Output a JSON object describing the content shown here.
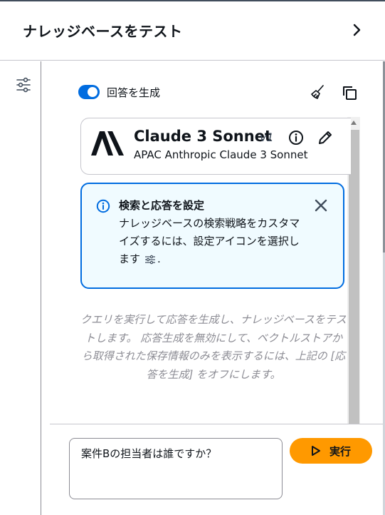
{
  "header": {
    "title": "ナレッジベースをテスト"
  },
  "icons": {
    "expand": "chevron-right-icon",
    "settings": "settings-sliders-icon",
    "clear": "broom-icon",
    "copy": "copy-icon",
    "info": "info-circle-icon",
    "edit": "pencil-icon",
    "close": "close-icon",
    "run": "play-icon"
  },
  "generate": {
    "label": "回答を生成",
    "enabled": true
  },
  "model": {
    "name": "Claude 3 Sonnet",
    "version": "v1",
    "subtitle": "APAC Anthropic Claude 3 Sonnet",
    "logo_text": "A\\"
  },
  "alert": {
    "title": "検索と応答を設定",
    "body_before": "ナレッジベースの検索戦略をカスタマイズするには、設定アイコンを選択します",
    "body_after": "."
  },
  "placeholder_text": "クエリを実行して応答を生成し、ナレッジベースをテストします。 応答生成を無効にして、ベクトルストアから取得された保存情報のみを表示するには、上記の [応答を生成] をオフにします。",
  "query": {
    "value": "案件Bの担当者は誰ですか？"
  },
  "run_button": {
    "label": "実行"
  },
  "colors": {
    "accent": "#006ce0",
    "run_button": "#ff9900",
    "alert_background": "#f0fbff",
    "text": "#0f141a",
    "muted_text": "#8c8c94"
  }
}
